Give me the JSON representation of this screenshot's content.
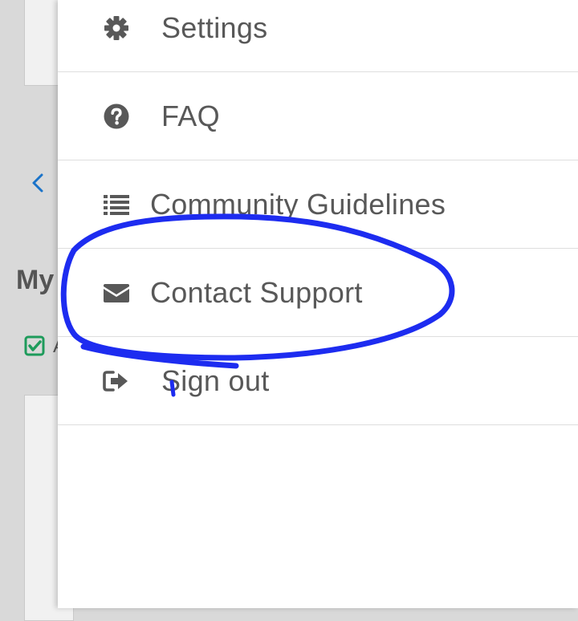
{
  "background": {
    "heading_partial": "My",
    "checkbox_text_partial": "A"
  },
  "menu": {
    "items": [
      {
        "label": "Settings",
        "icon": "gear-icon"
      },
      {
        "label": "FAQ",
        "icon": "question-circle-icon"
      },
      {
        "label": "Community Guidelines",
        "icon": "list-icon"
      },
      {
        "label": "Contact Support",
        "icon": "envelope-icon"
      },
      {
        "label": "Sign out",
        "icon": "sign-out-icon"
      }
    ]
  },
  "colors": {
    "icon": "#585858",
    "label": "#585858",
    "divider": "#dedede",
    "annotation_stroke": "#1d2cf0",
    "back_arrow": "#1a73c9",
    "checkbox": "#1e9b5b"
  }
}
